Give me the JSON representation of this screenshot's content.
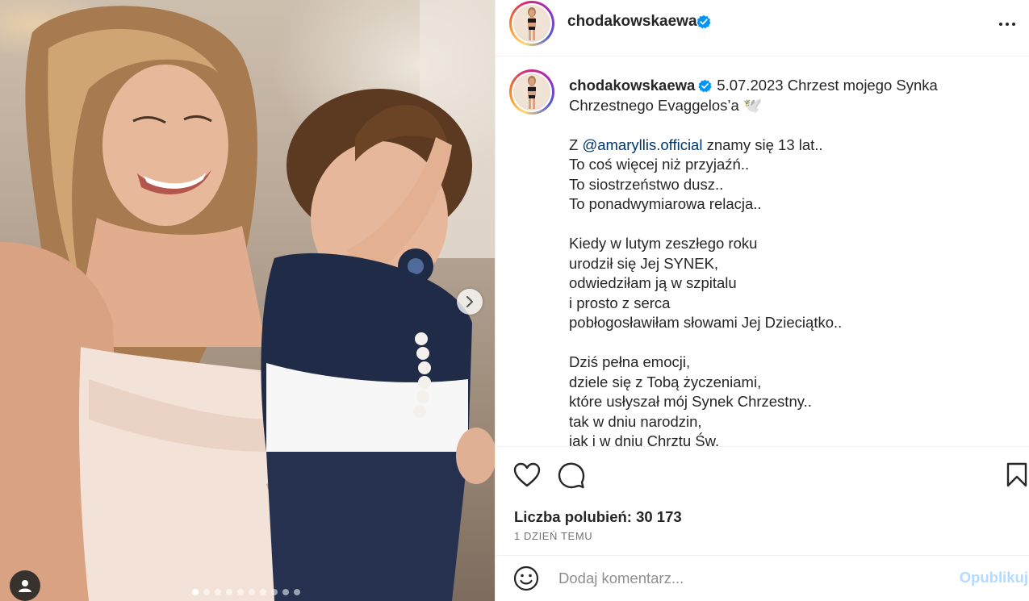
{
  "photo": {
    "alt_icon": "photo-of-woman-holding-child",
    "next_icon": "chevron-right-icon",
    "tag_icon": "user-tag-icon",
    "carousel": {
      "total": 10,
      "active": 1
    }
  },
  "post": {
    "author": "chodakowskaewa",
    "verified": true,
    "caption_lines": [
      "Chrzestnego Evaggelos’a 🕊️",
      "",
      "Z|@amaryllis.official|znamy się 13 lat..",
      "To coś więcej niż przyjaźń..",
      "To siostrzeństwo dusz..",
      "To ponadwymiarowa relacja..",
      "",
      "Kiedy w lutym zeszłego roku",
      "urodził się Jej SYNEK,",
      "odwiedziłam ją w szpitalu",
      "i prosto z serca",
      "pobłogosławiłam słowami Jej Dzieciątko..",
      "",
      "Dziś pełna emocji,",
      "dziele się z Tobą życzeniami,",
      "które usłyszał mój Synek Chrzestny..",
      "tak w dniu narodzin,",
      "jak i w dniu Chrztu Św."
    ],
    "caption_first": "5.07.2023 Chrzest mojego Synka",
    "mention": "@amaryllis.official",
    "likes_text": "Liczba polubień: 30 173",
    "time_ago": "1 DZIEŃ TEMU"
  },
  "comment": {
    "placeholder": "Dodaj komentarz...",
    "publish_label": "Opublikuj"
  },
  "colors": {
    "accent_link": "#00376b",
    "verified_blue": "#0095f6",
    "publish_disabled": "#b3dbff"
  }
}
